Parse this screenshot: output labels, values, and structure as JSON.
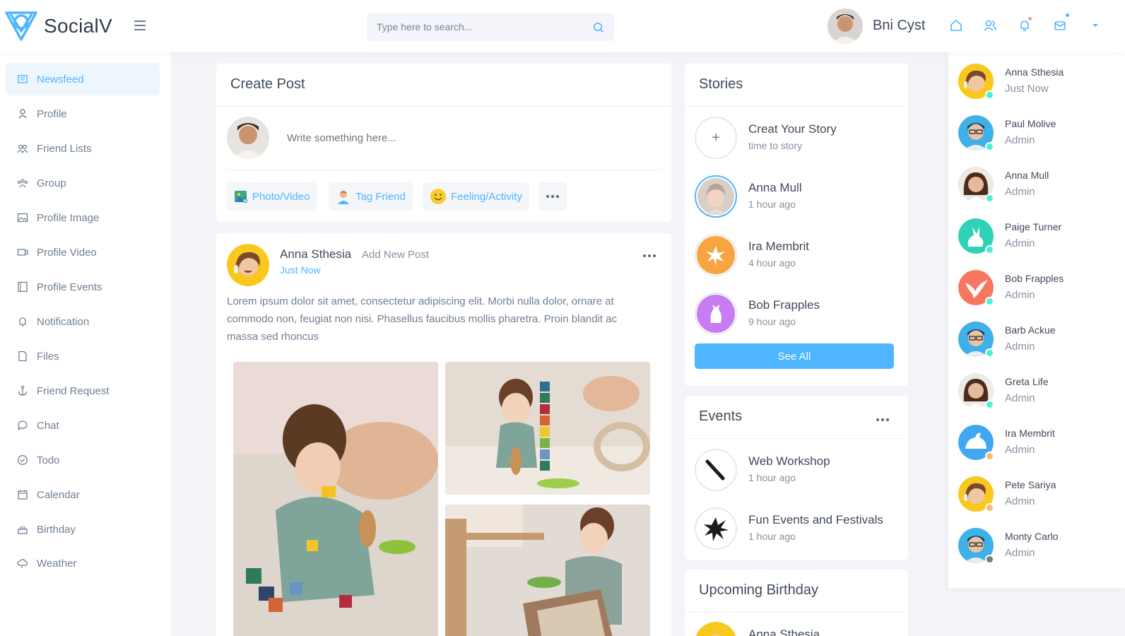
{
  "brand": {
    "name": "SocialV"
  },
  "search": {
    "placeholder": "Type here to search..."
  },
  "header": {
    "user_name": "Bni Cyst",
    "accent": "#50b5ff"
  },
  "sidebar": {
    "items": [
      {
        "label": "Newsfeed",
        "icon": "newsfeed-icon"
      },
      {
        "label": "Profile",
        "icon": "user-icon"
      },
      {
        "label": "Friend Lists",
        "icon": "users-icon"
      },
      {
        "label": "Group",
        "icon": "group-icon"
      },
      {
        "label": "Profile Image",
        "icon": "image-icon"
      },
      {
        "label": "Profile Video",
        "icon": "video-icon"
      },
      {
        "label": "Profile Events",
        "icon": "events-icon"
      },
      {
        "label": "Notification",
        "icon": "bell-icon"
      },
      {
        "label": "Files",
        "icon": "file-icon"
      },
      {
        "label": "Friend Request",
        "icon": "anchor-icon"
      },
      {
        "label": "Chat",
        "icon": "chat-icon"
      },
      {
        "label": "Todo",
        "icon": "check-circle-icon"
      },
      {
        "label": "Calendar",
        "icon": "calendar-icon"
      },
      {
        "label": "Birthday",
        "icon": "cake-icon"
      },
      {
        "label": "Weather",
        "icon": "cloud-icon"
      }
    ]
  },
  "create_post": {
    "title": "Create Post",
    "placeholder": "Write something here...",
    "actions": [
      {
        "label": "Photo/Video",
        "icon": "photo-icon"
      },
      {
        "label": "Tag Friend",
        "icon": "tag-friend-icon"
      },
      {
        "label": "Feeling/Activity",
        "icon": "smiley-icon"
      }
    ]
  },
  "post": {
    "author": "Anna Sthesia",
    "action_text": "Add New Post",
    "time": "Just Now",
    "body": "Lorem ipsum dolor sit amet, consectetur adipiscing elit. Morbi nulla dolor, ornare at commodo non, feugiat non nisi. Phasellus faucibus mollis pharetra. Proin blandit ac massa sed rhoncus"
  },
  "stories": {
    "title": "Stories",
    "items": [
      {
        "name": "Creat Your Story",
        "time": "time to story"
      },
      {
        "name": "Anna Mull",
        "time": "1 hour ago"
      },
      {
        "name": "Ira Membrit",
        "time": "4 hour ago"
      },
      {
        "name": "Bob Frapples",
        "time": "9 hour ago"
      }
    ],
    "see_all": "See All"
  },
  "events": {
    "title": "Events",
    "items": [
      {
        "name": "Web Workshop",
        "time": "1 hour ago"
      },
      {
        "name": "Fun Events and Festivals",
        "time": "1 hour ago"
      }
    ]
  },
  "birthday": {
    "title": "Upcoming Birthday",
    "first_name": "Anna Sthesia"
  },
  "online": {
    "friends": [
      {
        "name": "Anna Sthesia",
        "role": "Just Now",
        "status": "online"
      },
      {
        "name": "Paul Molive",
        "role": "Admin",
        "status": "online"
      },
      {
        "name": "Anna Mull",
        "role": "Admin",
        "status": "online"
      },
      {
        "name": "Paige Turner",
        "role": "Admin",
        "status": "online"
      },
      {
        "name": "Bob Frapples",
        "role": "Admin",
        "status": "online"
      },
      {
        "name": "Barb Ackue",
        "role": "Admin",
        "status": "online"
      },
      {
        "name": "Greta Life",
        "role": "Admin",
        "status": "online"
      },
      {
        "name": "Ira Membrit",
        "role": "Admin",
        "status": "away"
      },
      {
        "name": "Pete Sariya",
        "role": "Admin",
        "status": "away"
      },
      {
        "name": "Monty Carlo",
        "role": "Admin",
        "status": "offline"
      }
    ],
    "status_colors": {
      "online": "#49f0d3",
      "away": "#ffba68",
      "offline": "#777d74"
    }
  }
}
